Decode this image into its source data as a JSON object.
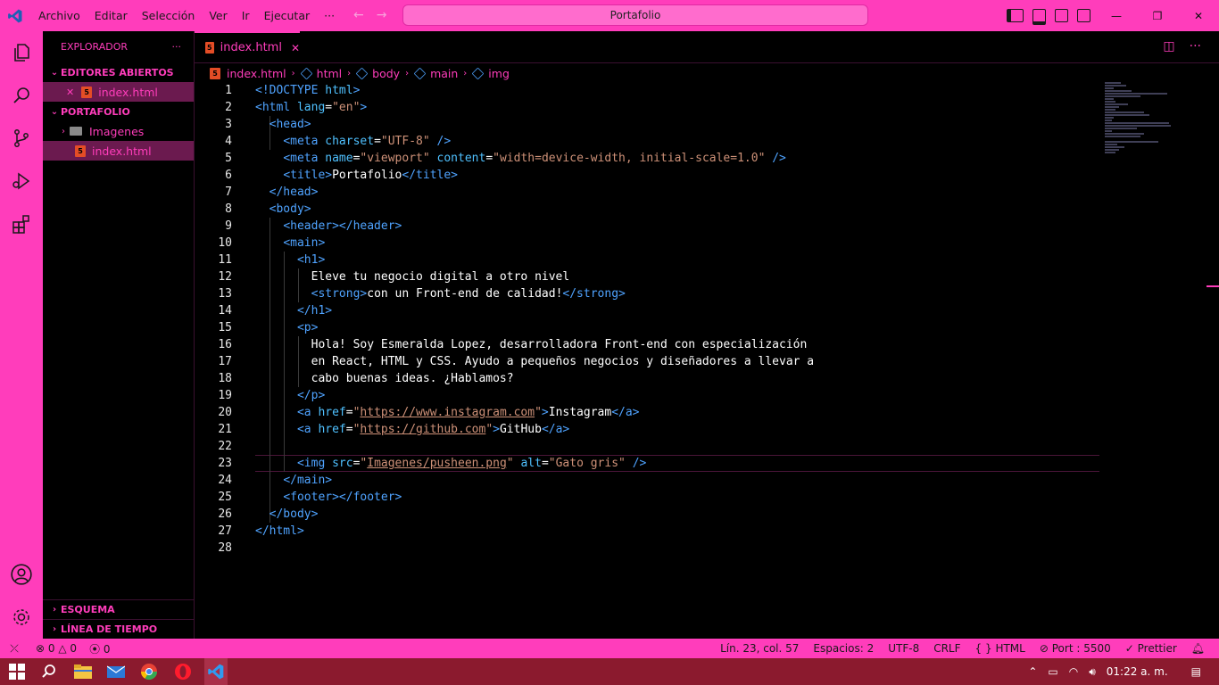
{
  "window": {
    "menu": [
      "Archivo",
      "Editar",
      "Selección",
      "Ver",
      "Ir",
      "Ejecutar",
      "···"
    ],
    "search_title": "Portafolio",
    "accent": "#ff3dbb"
  },
  "sidebar": {
    "title": "EXPLORADOR",
    "more": "···",
    "open_editors_label": "EDITORES ABIERTOS",
    "open_editors": [
      {
        "name": "index.html"
      }
    ],
    "folder_label": "PORTAFOLIO",
    "tree": [
      {
        "name": "Imagenes",
        "type": "folder"
      },
      {
        "name": "index.html",
        "type": "file"
      }
    ],
    "outline_label": "ESQUEMA",
    "timeline_label": "LÍNEA DE TIEMPO"
  },
  "editor": {
    "tab": {
      "label": "index.html",
      "close": "✕"
    },
    "breadcrumb": [
      "index.html",
      "html",
      "body",
      "main",
      "img"
    ],
    "line_numbers": [
      "1",
      "2",
      "3",
      "4",
      "5",
      "6",
      "7",
      "8",
      "9",
      "10",
      "11",
      "12",
      "13",
      "14",
      "15",
      "16",
      "17",
      "18",
      "19",
      "20",
      "21",
      "22",
      "23",
      "24",
      "25",
      "26",
      "27",
      "28"
    ]
  },
  "status": {
    "errors": "0",
    "warnings": "0",
    "ports": "0",
    "position": "Lín. 23, col. 57",
    "spaces": "Espacios: 2",
    "encoding": "UTF-8",
    "eol": "CRLF",
    "language": "HTML",
    "port": "Port : 5500",
    "prettier": "Prettier"
  },
  "taskbar": {
    "time": "01:22 a. m."
  }
}
